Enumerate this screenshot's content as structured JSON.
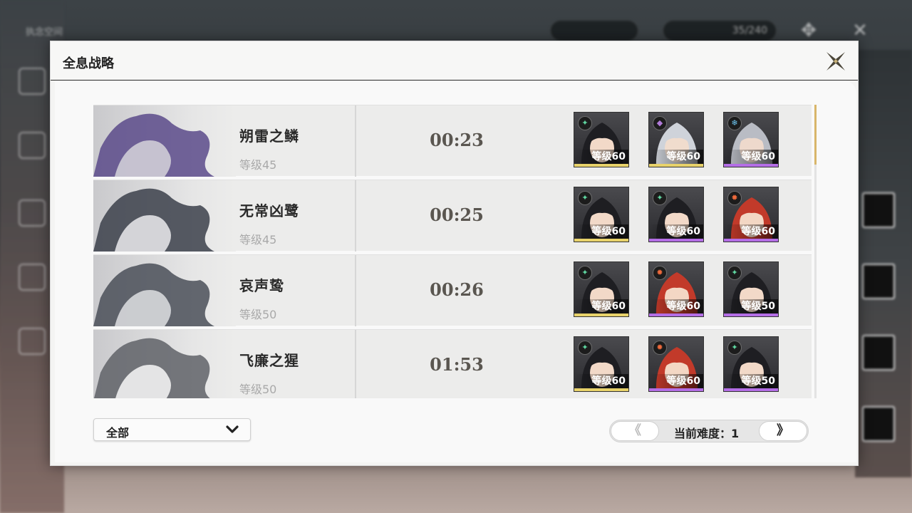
{
  "background": {
    "top_title": "执念空间",
    "currency": "35/240"
  },
  "modal": {
    "title": "全息战略",
    "close_icon": "close-x-icon"
  },
  "entries": [
    {
      "name": "朔雷之鳞",
      "level": "等级45",
      "time": "00:23",
      "team": [
        {
          "element": "aero",
          "level": "等级60",
          "rarity": "gold"
        },
        {
          "element": "havoc",
          "level": "等级60",
          "rarity": "gold"
        },
        {
          "element": "glacio",
          "level": "等级60",
          "rarity": "purple"
        }
      ]
    },
    {
      "name": "无常凶鹭",
      "level": "等级45",
      "time": "00:25",
      "team": [
        {
          "element": "aero",
          "level": "等级60",
          "rarity": "gold"
        },
        {
          "element": "aero",
          "level": "等级60",
          "rarity": "purple"
        },
        {
          "element": "fusion",
          "level": "等级60",
          "rarity": "purple"
        }
      ]
    },
    {
      "name": "哀声鸷",
      "level": "等级50",
      "time": "00:26",
      "team": [
        {
          "element": "aero",
          "level": "等级60",
          "rarity": "gold"
        },
        {
          "element": "fusion",
          "level": "等级60",
          "rarity": "purple"
        },
        {
          "element": "aero",
          "level": "等级50",
          "rarity": "purple"
        }
      ]
    },
    {
      "name": "飞廉之猩",
      "level": "等级50",
      "time": "01:53",
      "team": [
        {
          "element": "aero",
          "level": "等级60",
          "rarity": "gold"
        },
        {
          "element": "fusion",
          "level": "等级60",
          "rarity": "purple"
        },
        {
          "element": "aero",
          "level": "等级50",
          "rarity": "purple"
        }
      ]
    }
  ],
  "filter": {
    "selected": "全部"
  },
  "pager": {
    "prev_label": "《",
    "next_label": "》",
    "difficulty_label": "当前难度：1"
  },
  "colors": {
    "gold": "#e8d26a",
    "purple": "#b46ee6",
    "aero": "#5fd6a0",
    "havoc": "#b07ad8",
    "glacio": "#6cc3ec",
    "fusion": "#ef6a3c"
  }
}
